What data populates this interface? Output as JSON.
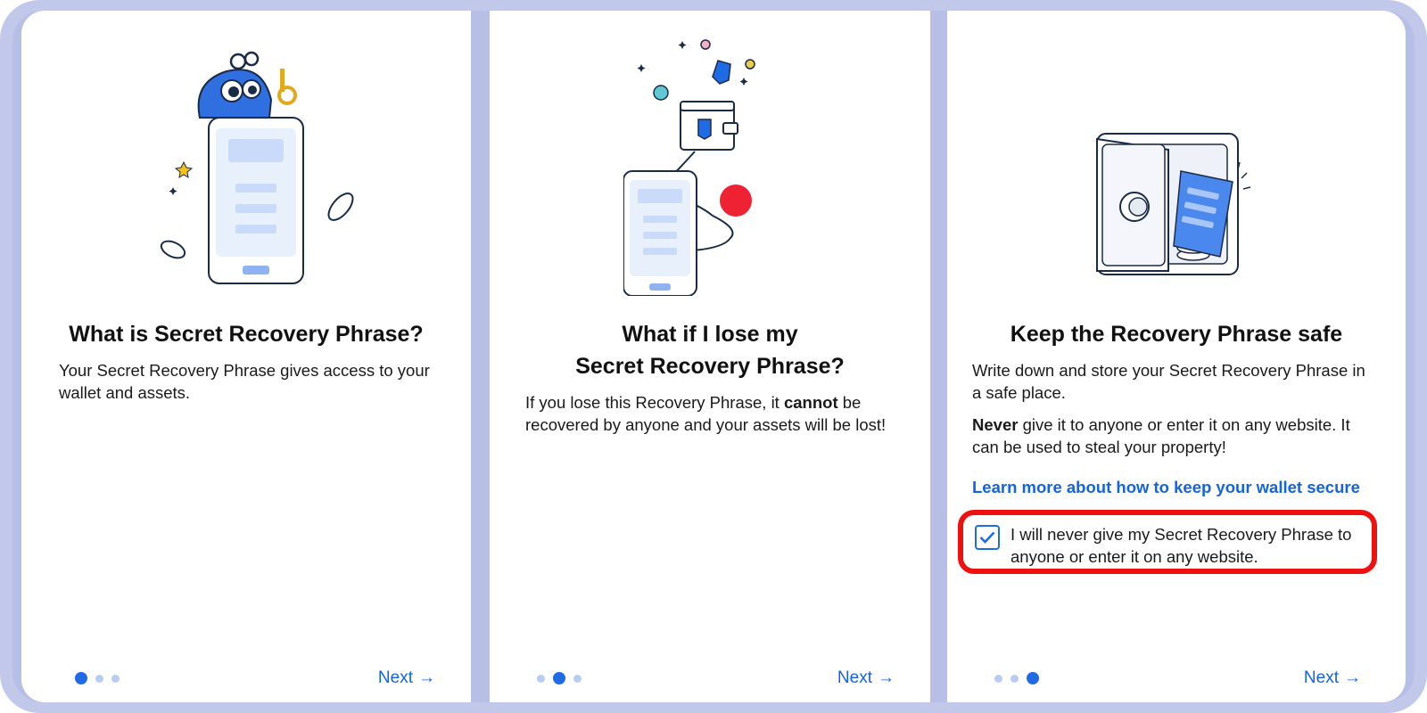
{
  "steps": [
    {
      "title": "What is Secret Recovery Phrase?",
      "body": "Your Secret Recovery Phrase gives access to your wallet and assets.",
      "next_label": "Next",
      "active_dot": 1
    },
    {
      "title_line1": "What if I lose my",
      "title_line2": "Secret Recovery Phrase?",
      "body_part1": "If you lose this Recovery Phrase, it ",
      "body_bold": "cannot",
      "body_part2": " be recovered by anyone and your assets will be lost!",
      "next_label": "Next",
      "active_dot": 2
    },
    {
      "title": "Keep the Recovery Phrase safe",
      "body": "Write down and store your Secret Recovery Phrase in a safe place.",
      "warning_bold": "Never",
      "warning_rest": " give it to anyone or enter it on any website. It can be used to steal your property!",
      "learn_more_link": "Learn more about how to keep your wallet secure",
      "checkbox_label": "I will never give my Secret Recovery Phrase to anyone or enter it on any website.",
      "checkbox_checked": true,
      "next_label": "Next",
      "active_dot": 3
    }
  ],
  "icons": {
    "next_arrow": "arrow-right-icon",
    "check": "checkmark-icon"
  },
  "colors": {
    "accent": "#1f6be6",
    "link": "#1464e0",
    "highlight": "#ee1111",
    "record_dot": "#ee2233",
    "frame": "#c2c8ea"
  }
}
